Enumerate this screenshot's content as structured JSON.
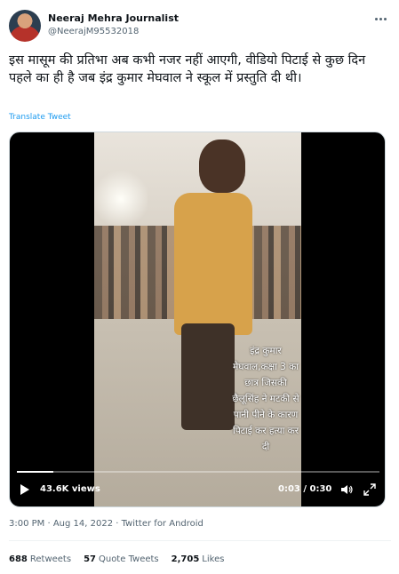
{
  "author": {
    "name": "Neeraj Mehra Journalist",
    "handle": "@NeerajM95532018"
  },
  "tweet": {
    "text": "इस मासूम की प्रतिभा अब कभी नजर नहीं आएगी, वीडियो पिटाई से कुछ दिन पहले का ही है जब इंद्र कुमार  मेघवाल ने  स्कूल में प्रस्तुति दी  थी।",
    "translate_label": "Translate Tweet"
  },
  "video": {
    "overlay_text": "इंद्र कुमार मेघवाल,कक्षा 3 का छात्र जिसकी छैलूसिंह ने मटकी से पानी पीने के कारण पिटाई कर हत्या कर दी",
    "views": "43.6K views",
    "time": "0:03 / 0:30",
    "progress": 0.1
  },
  "meta": {
    "timestamp": "3:00 PM · Aug 14, 2022 · Twitter for Android"
  },
  "stats": {
    "retweets_count": "688",
    "retweets_label": "Retweets",
    "quotes_count": "57",
    "quotes_label": "Quote Tweets",
    "likes_count": "2,705",
    "likes_label": "Likes"
  }
}
